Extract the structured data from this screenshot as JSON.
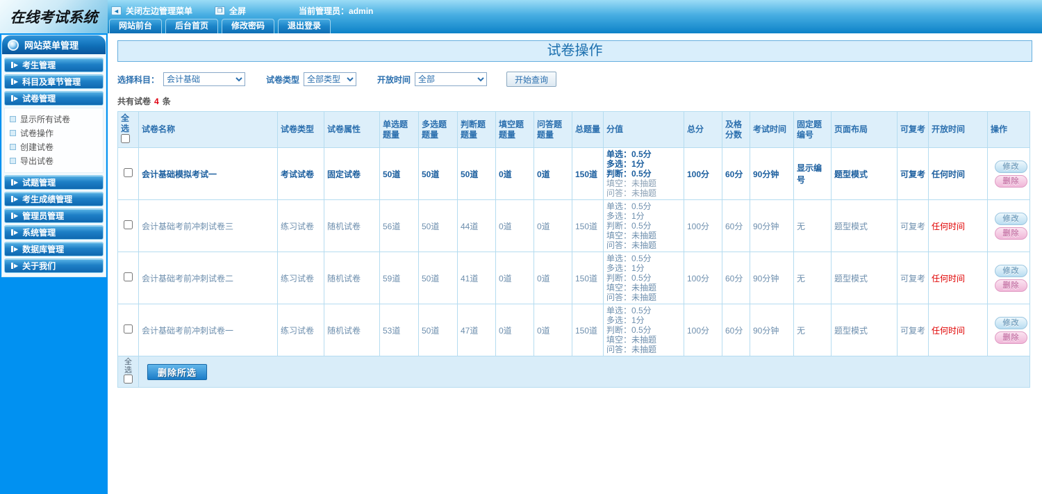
{
  "topbar": {
    "logo": "在线考试系统",
    "close_menu": "关闭左边管理菜单",
    "fullscreen": "全屏",
    "admin_label": "当前管理员：admin",
    "tabs": [
      "网站前台",
      "后台首页",
      "修改密码",
      "退出登录"
    ]
  },
  "sidebar": {
    "header": "网站菜单管理",
    "items": [
      "考生管理",
      "科目及章节管理",
      "试卷管理",
      "试题管理",
      "考生成绩管理",
      "管理员管理",
      "系统管理",
      "数据库管理",
      "关于我们"
    ],
    "submenu": [
      "显示所有试卷",
      "试卷操作",
      "创建试卷",
      "导出试卷"
    ]
  },
  "main": {
    "title": "试卷操作",
    "filters": {
      "subject_label": "选择科目：",
      "subject_value": "会计基础",
      "type_label": "试卷类型",
      "type_value": "全部类型",
      "time_label": "开放时间",
      "time_value": "全部",
      "search_button": "开始查询"
    },
    "count": {
      "prefix": "共有试卷",
      "num": "4",
      "suffix": "条"
    },
    "table": {
      "headers": [
        "全选",
        "试卷名称",
        "试卷类型",
        "试卷属性",
        "单选题题量",
        "多选题题量",
        "判断题题量",
        "填空题题量",
        "问答题题量",
        "总题量",
        "分值",
        "总分",
        "及格分数",
        "考试时间",
        "固定题编号",
        "页面布局",
        "可复考",
        "开放时间",
        "操作"
      ],
      "action_modify": "修改",
      "action_delete": "删除",
      "rows": [
        {
          "name": "会计基础模拟考试一",
          "type": "考试试卷",
          "attr": "固定试卷",
          "single": "50道",
          "multi": "50道",
          "judge": "50道",
          "blank": "0道",
          "qa": "0道",
          "total": "150道",
          "score": [
            "单选：0.5分",
            "多选：1分",
            "判断：0.5分",
            "填空：未抽题",
            "问答：未抽题"
          ],
          "total_score": "100分",
          "pass": "60分",
          "time": "90分钟",
          "fixed": "显示编号",
          "layout": "题型模式",
          "retake": "可复考",
          "open": "任何时间"
        },
        {
          "name": "会计基础考前冲刺试卷三",
          "type": "练习试卷",
          "attr": "随机试卷",
          "single": "56道",
          "multi": "50道",
          "judge": "44道",
          "blank": "0道",
          "qa": "0道",
          "total": "150道",
          "score": [
            "单选：0.5分",
            "多选：1分",
            "判断：0.5分",
            "填空：未抽题",
            "问答：未抽题"
          ],
          "total_score": "100分",
          "pass": "60分",
          "time": "90分钟",
          "fixed": "无",
          "layout": "题型模式",
          "retake": "可复考",
          "open": "任何时间"
        },
        {
          "name": "会计基础考前冲刺试卷二",
          "type": "练习试卷",
          "attr": "随机试卷",
          "single": "59道",
          "multi": "50道",
          "judge": "41道",
          "blank": "0道",
          "qa": "0道",
          "total": "150道",
          "score": [
            "单选：0.5分",
            "多选：1分",
            "判断：0.5分",
            "填空：未抽题",
            "问答：未抽题"
          ],
          "total_score": "100分",
          "pass": "60分",
          "time": "90分钟",
          "fixed": "无",
          "layout": "题型模式",
          "retake": "可复考",
          "open": "任何时间"
        },
        {
          "name": "会计基础考前冲刺试卷一",
          "type": "练习试卷",
          "attr": "随机试卷",
          "single": "53道",
          "multi": "50道",
          "judge": "47道",
          "blank": "0道",
          "qa": "0道",
          "total": "150道",
          "score": [
            "单选：0.5分",
            "多选：1分",
            "判断：0.5分",
            "填空：未抽题",
            "问答：未抽题"
          ],
          "total_score": "100分",
          "pass": "60分",
          "time": "90分钟",
          "fixed": "无",
          "layout": "题型模式",
          "retake": "可复考",
          "open": "任何时间"
        }
      ]
    },
    "footer": {
      "select_all": "全选",
      "delete_button": "删除所选"
    }
  }
}
